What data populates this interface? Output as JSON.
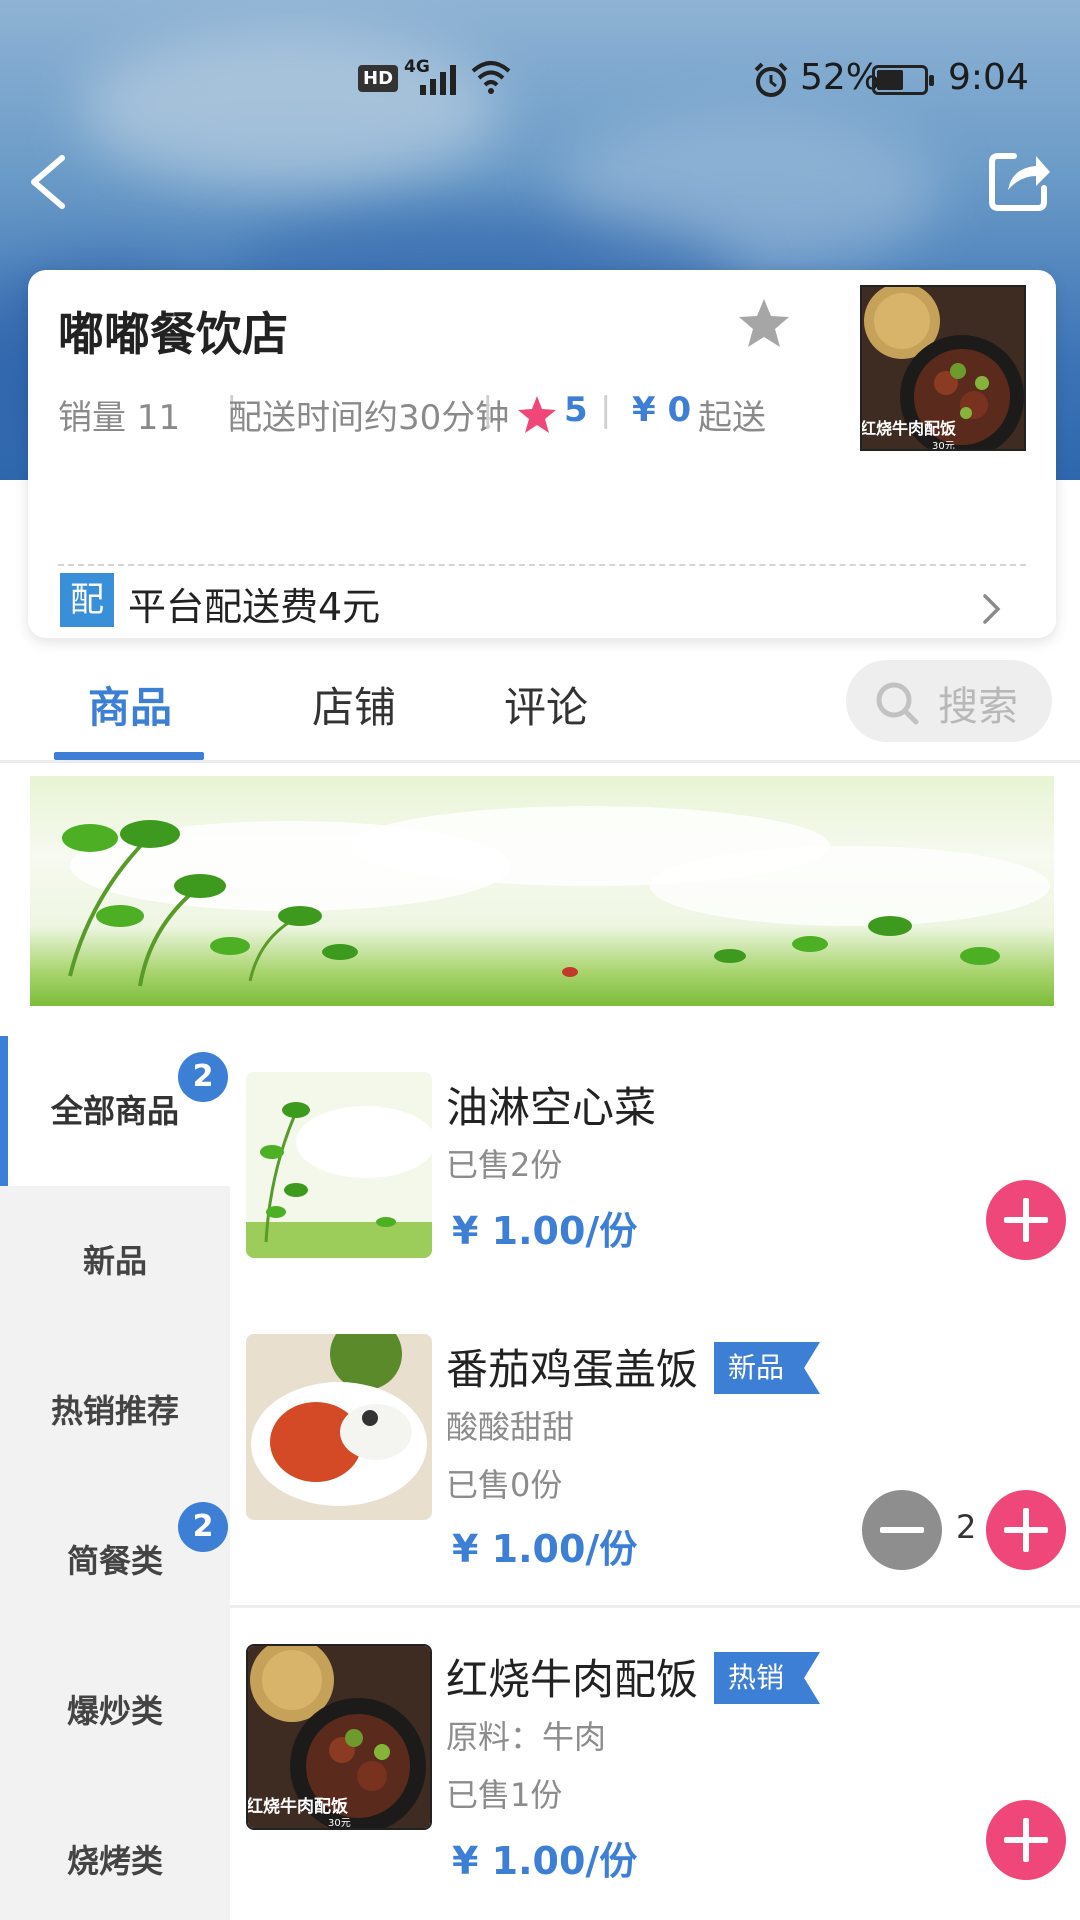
{
  "status_bar": {
    "hd": "HD",
    "network": "4G",
    "battery_percent": "52%",
    "battery_level": 0.52,
    "time": "9:04"
  },
  "header": {
    "back_icon": "chevron-left-icon",
    "share_icon": "share-icon"
  },
  "shop": {
    "name": "嘟嘟餐饮店",
    "sales": "销量 11",
    "delivery_time": "配送时间约30分钟",
    "rating": "5",
    "min_price": "¥ 0",
    "min_price_suffix": "起送",
    "thumb_caption": "红烧牛肉配饭",
    "thumb_price": "30元",
    "delivery_badge": "配",
    "delivery_fee": "平台配送费4元"
  },
  "tabs": [
    {
      "label": "商品",
      "active": true
    },
    {
      "label": "店铺",
      "active": false
    },
    {
      "label": "评论",
      "active": false
    }
  ],
  "search": {
    "placeholder": "搜索"
  },
  "categories": [
    {
      "label": "全部商品",
      "badge": "2",
      "active": true
    },
    {
      "label": "新品",
      "badge": "",
      "active": false
    },
    {
      "label": "热销推荐",
      "badge": "",
      "active": false
    },
    {
      "label": "简餐类",
      "badge": "2",
      "active": false
    },
    {
      "label": "爆炒类",
      "badge": "",
      "active": false
    },
    {
      "label": "烧烤类",
      "badge": "",
      "active": false
    }
  ],
  "products": [
    {
      "name": "油淋空心菜",
      "tag": "",
      "desc": "",
      "sold": "已售2份",
      "price": "¥ 1.00/份",
      "qty": ""
    },
    {
      "name": "番茄鸡蛋盖饭",
      "tag": "新品",
      "desc": "酸酸甜甜",
      "sold": "已售0份",
      "price": "¥ 1.00/份",
      "qty": "2"
    },
    {
      "name": "红烧牛肉配饭",
      "tag": "热销",
      "desc": "原料：牛肉",
      "sold": "已售1份",
      "price": "¥ 1.00/份",
      "qty": "",
      "thumb_caption": "红烧牛肉配饭",
      "thumb_price": "30元"
    }
  ],
  "colors": {
    "accent": "#3e7fd6",
    "add_button": "#f0477a",
    "rating_star": "#f0477a"
  }
}
